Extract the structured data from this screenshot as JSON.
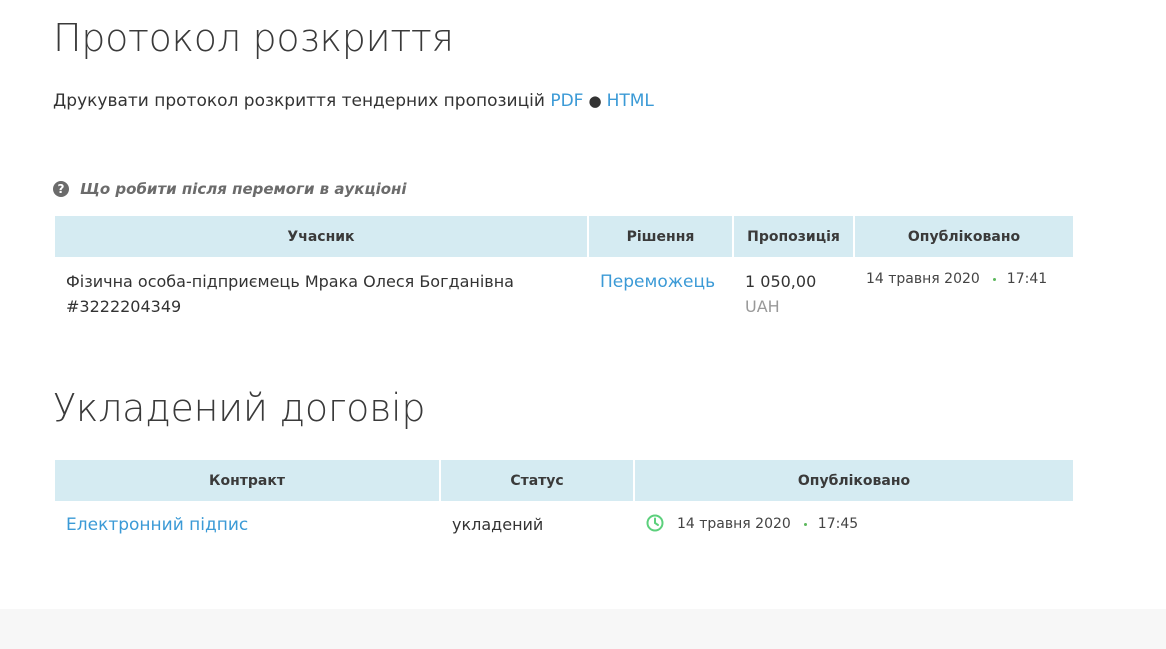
{
  "protocol": {
    "title": "Протокол розкриття",
    "print_text": "Друкувати протокол розкриття тендерних пропозицій",
    "pdf_link": "PDF",
    "separator": "●",
    "html_link": "HTML",
    "help_text": "Що робити після перемоги в аукціоні",
    "help_icon": "question-circle-icon"
  },
  "bids_table": {
    "headers": [
      "Учасник",
      "Рішення",
      "Пропозиція",
      "Опубліковано"
    ],
    "rows": [
      {
        "participant": "Фізична особа-підприємець Мрака Олеся Богданівна",
        "participant_id": "#3222204349",
        "decision": "Переможець",
        "amount": "1 050,00",
        "currency": "UAH",
        "date": "14 травня 2020",
        "time": "17:41"
      }
    ]
  },
  "contract_section": {
    "title": "Укладений договір",
    "headers": [
      "Контракт",
      "Статус",
      "Опубліковано"
    ],
    "rows": [
      {
        "contract": "Електронний підпис",
        "status": "укладений",
        "date": "14 травня 2020",
        "time": "17:45",
        "icon": "clock-icon"
      }
    ]
  },
  "colors": {
    "link": "#3b9ad6",
    "header_bg": "#d5ebf2",
    "clock": "#5cd07c",
    "dot": "#5cb85c"
  }
}
